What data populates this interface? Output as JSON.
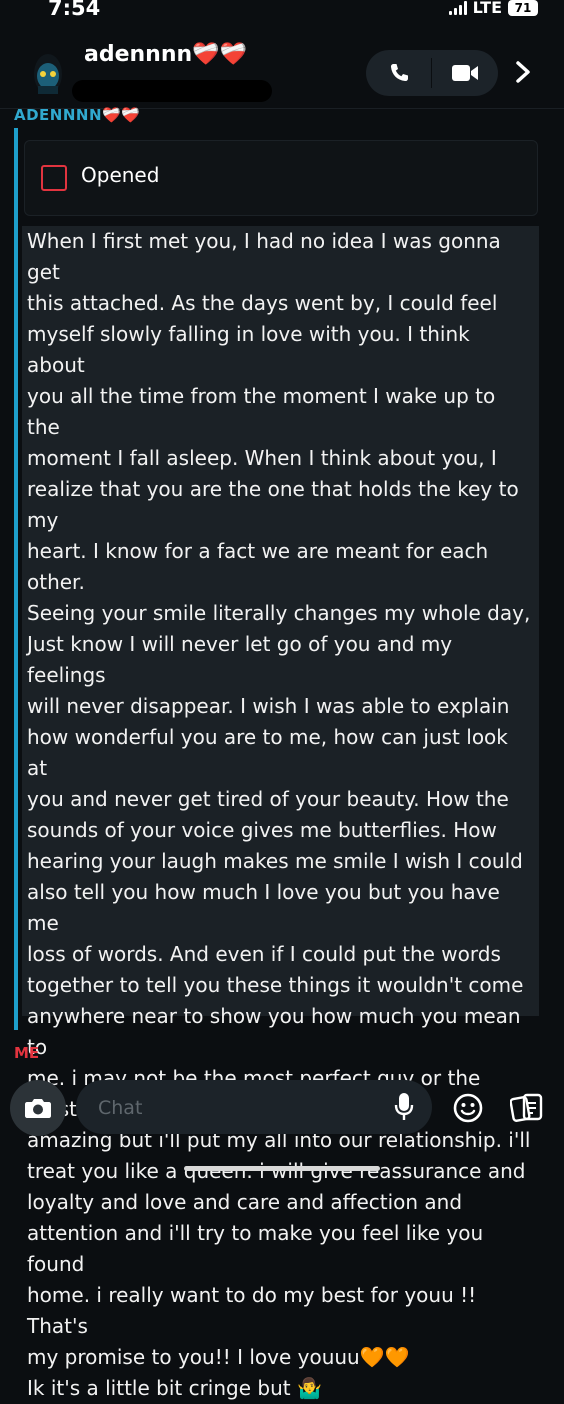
{
  "status_bar": {
    "time": "7:54",
    "network": "LTE",
    "battery": "71"
  },
  "header": {
    "contact_name": "adennnn❤️‍🩹❤️‍🩹"
  },
  "chat": {
    "sender_label": "ADENNNN❤️‍🩹❤️‍🩹",
    "opened_label": "Opened",
    "message_text": "When I first met you, I had no idea I was gonna get\nthis attached. As the days went by, I could feel\nmyself slowly falling in love with you. I think about\nyou all the time from the moment I wake up to the\nmoment I fall asleep. When I think about you, I\nrealize that you are the one that holds the key to my\nheart. I know for a fact we are meant for each other.\nSeeing your smile literally changes my whole day,\nJust know I will never let go of you and my feelings\nwill never disappear. I wish I was able to explain\nhow wonderful you are to me, how can just look at\nyou and never get tired of your beauty. How the\nsounds of your voice gives me butterflies. How\nhearing your laugh makes me smile I wish I could\nalso tell you how much I love you but you have me\nloss of words. And even if I could put the words\ntogether to tell you these things it wouldn't come\nanywhere near to show you how much you mean to\nme. i may not be the most perfect guy or the most\namazing but i'll put my all into our relationship. i'll\ntreat you like a queen. i will give reassurance and\nloyalty and love and care and affection and\nattention and i'll try to make you feel like you found\nhome. i really want to do my best for youu !! That's\nmy promise to you!! I love youuu🧡🧡\nIk it's a little bit cringe but 🤷‍♂️",
    "me_label": "ME"
  },
  "composer": {
    "placeholder": "Chat"
  },
  "icons": {
    "back": "chevron-right-icon",
    "call": "phone-icon",
    "video": "video-camera-icon",
    "camera": "camera-icon",
    "mic": "microphone-icon",
    "emoji": "emoji-icon",
    "stickers": "sticker-icon"
  },
  "colors": {
    "background": "#0b0e11",
    "bubble": "#1b2126",
    "sender_accent": "#1e9fcb",
    "me_accent": "#e2343f"
  }
}
